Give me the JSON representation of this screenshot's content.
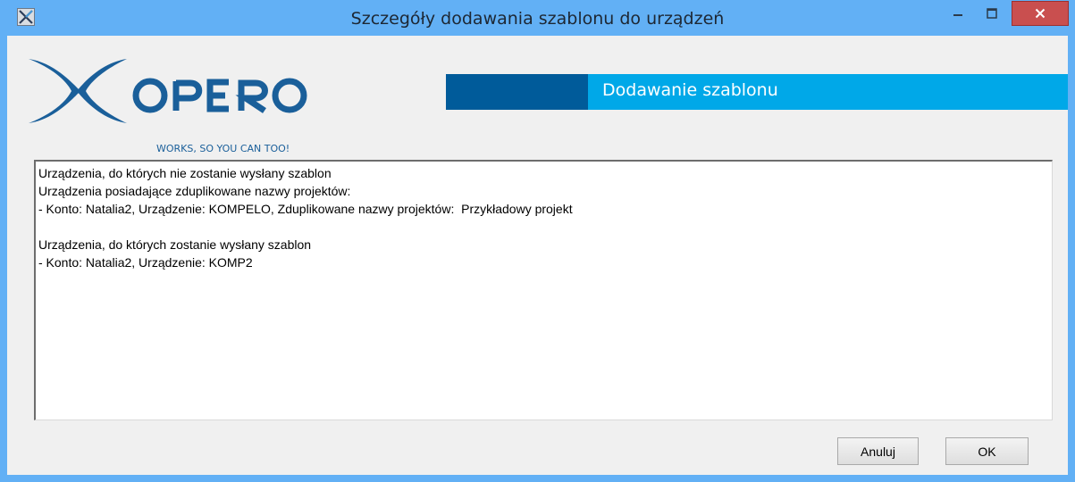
{
  "window": {
    "title": "Szczegóły dodawania szablonu do urządzeń"
  },
  "header": {
    "logo_text": "XOPERO",
    "logo_tagline": "WORKS, SO YOU CAN TOO!",
    "banner_title": "Dodawanie szablonu"
  },
  "details": {
    "lines": [
      "Urządzenia, do których nie zostanie wysłany szablon",
      "Urządzenia posiadające zduplikowane nazwy projektów:",
      "- Konto: Natalia2, Urządzenie: KOMPELO, Zduplikowane nazwy projektów:  Przykładowy projekt",
      "",
      "Urządzenia, do których zostanie wysłany szablon",
      "- Konto: Natalia2, Urządzenie: KOMP2"
    ]
  },
  "buttons": {
    "cancel_label": "Anuluj",
    "ok_label": "OK"
  },
  "colors": {
    "titlebar": "#62b0f5",
    "banner_dark": "#005b9a",
    "banner_light": "#00a8e8",
    "close_button": "#c94f4f",
    "logo_blue": "#1a5f9a"
  }
}
